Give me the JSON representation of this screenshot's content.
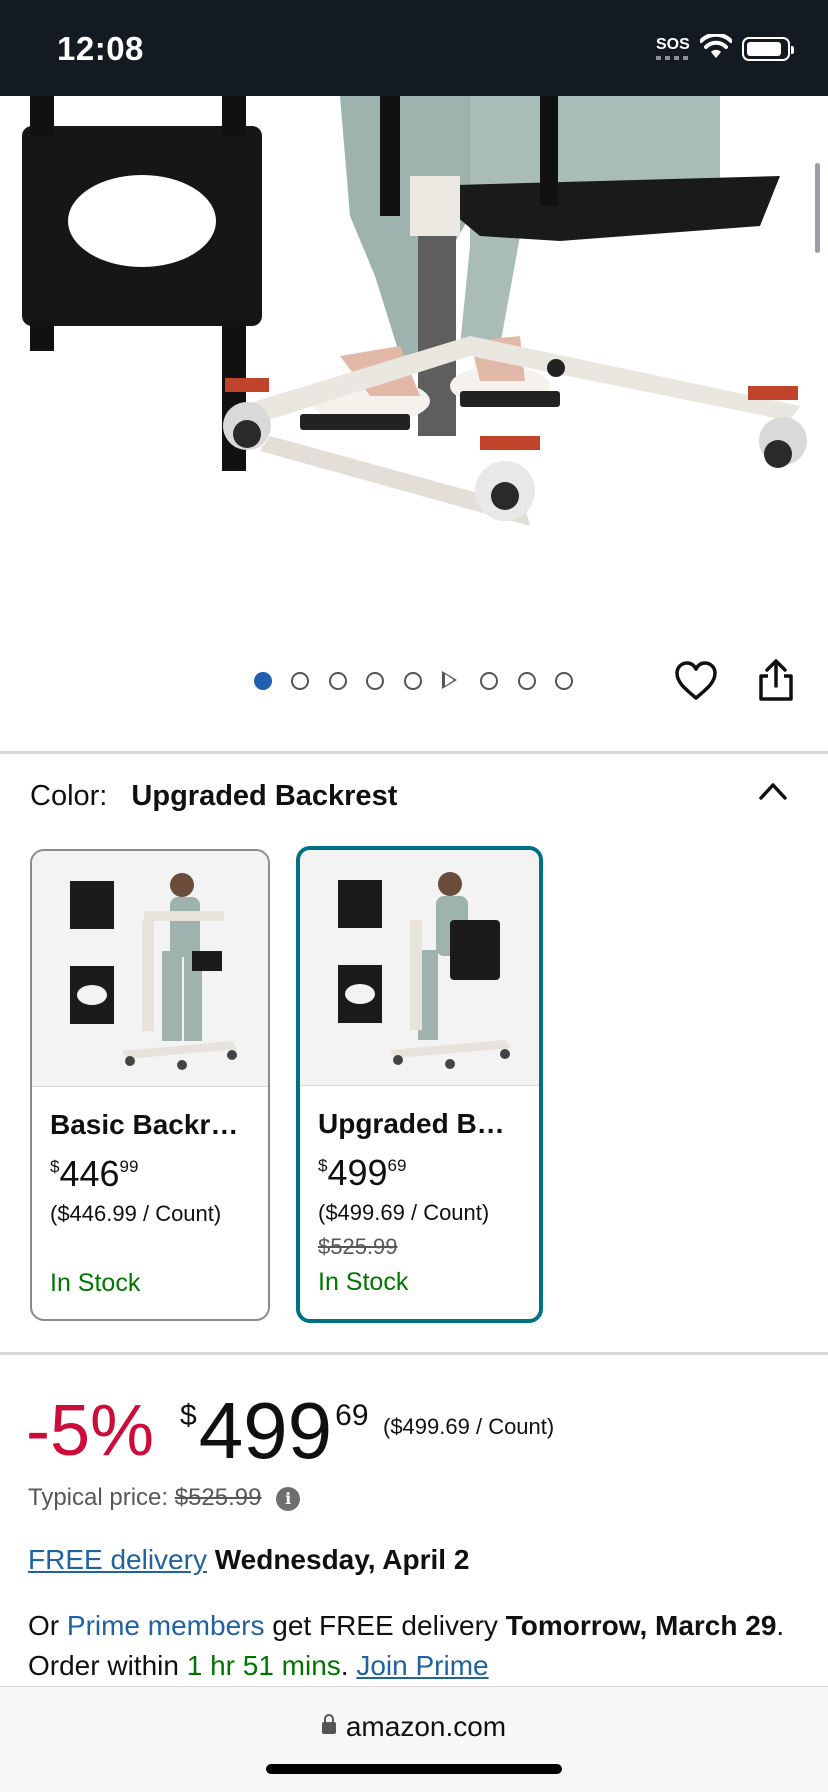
{
  "status_bar": {
    "time": "12:08",
    "sos": "SOS"
  },
  "gallery": {
    "image_count": 9,
    "active_index": 0,
    "video_index": 5
  },
  "color": {
    "label": "Color:",
    "selected": "Upgraded Backrest",
    "options": [
      {
        "name": "Basic Backr…",
        "price_dollars": "446",
        "price_cents": "99",
        "currency": "$",
        "unit_price": "($446.99 / Count)",
        "list_price": "",
        "stock": "In Stock"
      },
      {
        "name": "Upgraded B…",
        "price_dollars": "499",
        "price_cents": "69",
        "currency": "$",
        "unit_price": "($499.69 / Count)",
        "list_price": "$525.99",
        "stock": "In Stock"
      }
    ]
  },
  "pricing": {
    "discount": "-5%",
    "currency": "$",
    "dollars": "499",
    "cents": "69",
    "unit_price": "($499.69 / Count)",
    "typical_label": "Typical price:",
    "typical_price": "$525.99"
  },
  "delivery": {
    "free_link": "FREE delivery",
    "date": "Wednesday, April 2"
  },
  "prime": {
    "prefix": "Or",
    "link": "Prime members",
    "middle": "get FREE delivery",
    "date": "Tomorrow, March 29",
    "order_within": "Order within",
    "countdown": "1 hr 51 mins",
    "join": "Join Prime"
  },
  "browser": {
    "url": "amazon.com"
  },
  "colors": {
    "accent_blue": "#2162a1",
    "deal_red": "#cc0c39",
    "stock_green": "#007600",
    "selected_border": "#007185"
  }
}
